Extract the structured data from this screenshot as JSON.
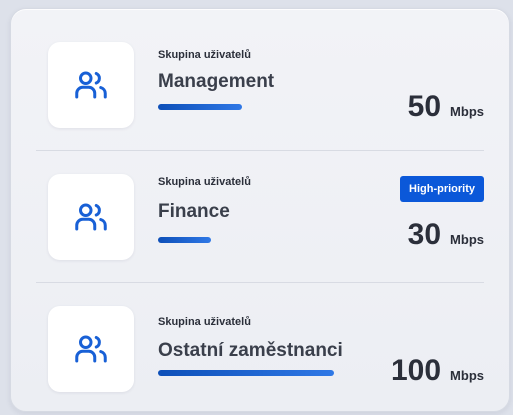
{
  "groups": [
    {
      "label": "Skupina uživatelů",
      "name": "Management",
      "bandwidth_value": "50",
      "bandwidth_unit": "Mbps",
      "bar_fraction": 0.5,
      "badge": ""
    },
    {
      "label": "Skupina uživatelů",
      "name": "Finance",
      "bandwidth_value": "30",
      "bandwidth_unit": "Mbps",
      "bar_fraction": 0.3,
      "badge": "High-priority"
    },
    {
      "label": "Skupina uživatelů",
      "name": "Ostatní zaměstnanci",
      "bandwidth_value": "100",
      "bandwidth_unit": "Mbps",
      "bar_fraction": 1.0,
      "badge": ""
    }
  ],
  "icon": "users-group-icon",
  "colors": {
    "accent": "#0b58d9",
    "bar": "#1a5fd0",
    "icon": "#1860d6"
  }
}
